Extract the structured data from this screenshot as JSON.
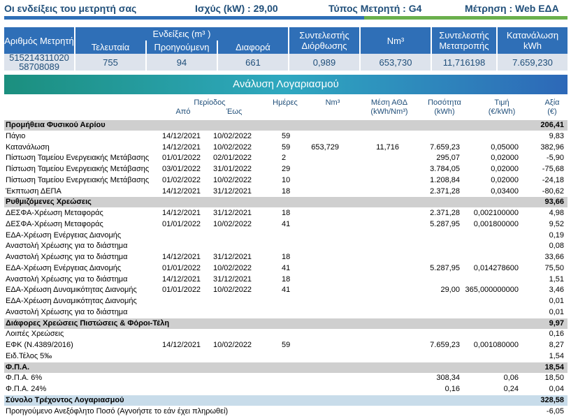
{
  "header": {
    "title": "Οι ενδείξεις του μετρητή σας",
    "power": "Ισχύς (kW) : 29,00",
    "meter_type": "Τύπος Μετρητή : G4",
    "measurement": "Μέτρηση : Web ΕΔΑ",
    "accent_blue": "#2f6fb7",
    "accent_green": "#6ab04c"
  },
  "meter_table": {
    "col_meter_no": "Αριθμός Μετρητή",
    "col_readings": "Ενδείξεις (m³ )",
    "col_last": "Τελευταία",
    "col_previous": "Προηγούμενη",
    "col_diff": "Διαφορά",
    "col_correction": "Συντελεστής Διόρθωσης",
    "col_nm3": "Nm³",
    "col_conversion": "Συντελεστής Μετατροπής",
    "col_kwh": "Κατανάλωση kWh",
    "meter_no_1": "515214311020",
    "meter_no_2": "58708089",
    "last": "755",
    "previous": "94",
    "diff": "661",
    "correction": "0,989",
    "nm3": "653,730",
    "conversion": "11,716198",
    "kwh": "7.659,230"
  },
  "analysis": {
    "title": "Ανάλυση Λογαριασμού",
    "headers": {
      "period": "Περίοδος",
      "from": "Από",
      "to": "Έως",
      "days": "Ημέρες",
      "nm3": "Nm³",
      "avg_1": "Μέση ΑΘΔ",
      "avg_2": "(kWh/Nm³)",
      "qty_1": "Ποσότητα",
      "qty_2": "(kWh)",
      "price_1": "Τιμή",
      "price_2": "(€/kWh)",
      "value_1": "Αξία",
      "value_2": "(€)"
    },
    "rows": [
      {
        "type": "section",
        "label": "Προμήθεια Φυσικού Αερίου",
        "value": "206,41"
      },
      {
        "label": "Πάγιο",
        "from": "14/12/2021",
        "to": "10/02/2022",
        "days": "59",
        "value": "9,83"
      },
      {
        "label": "Κατανάλωση",
        "from": "14/12/2021",
        "to": "10/02/2022",
        "days": "59",
        "nm3": "653,729",
        "avg": "11,716",
        "qty": "7.659,23",
        "price": "0,05000",
        "value": "382,96"
      },
      {
        "label": "Πίστωση Ταμείου Ενεργειακής Μετάβασης",
        "from": "01/01/2022",
        "to": "02/01/2022",
        "days": "2",
        "qty": "295,07",
        "price": "0,02000",
        "value": "-5,90"
      },
      {
        "label": "Πίστωση Ταμείου Ενεργειακής Μετάβασης",
        "from": "03/01/2022",
        "to": "31/01/2022",
        "days": "29",
        "qty": "3.784,05",
        "price": "0,02000",
        "value": "-75,68"
      },
      {
        "label": "Πίστωση Ταμείου Ενεργειακής Μετάβασης",
        "from": "01/02/2022",
        "to": "10/02/2022",
        "days": "10",
        "qty": "1.208,84",
        "price": "0,02000",
        "value": "-24,18"
      },
      {
        "label": "Έκπτωση ΔΕΠΑ",
        "from": "14/12/2021",
        "to": "31/12/2021",
        "days": "18",
        "qty": "2.371,28",
        "price": "0,03400",
        "value": "-80,62"
      },
      {
        "type": "section",
        "label": "Ρυθμιζόμενες Χρεώσεις",
        "value": "93,66"
      },
      {
        "label": "ΔΕΣΦΑ-Χρέωση Μεταφοράς",
        "from": "14/12/2021",
        "to": "31/12/2021",
        "days": "18",
        "qty": "2.371,28",
        "price": "0,002100000",
        "value": "4,98"
      },
      {
        "label": "ΔΕΣΦΑ-Χρέωση Μεταφοράς",
        "from": "01/01/2022",
        "to": "10/02/2022",
        "days": "41",
        "qty": "5.287,95",
        "price": "0,001800000",
        "value": "9,52"
      },
      {
        "label": "ΕΔΑ-Χρέωση Ενέργειας Διανομής",
        "value": "0,19"
      },
      {
        "label": "Αναστολή Χρέωσης για το διάστημα",
        "value": "0,08"
      },
      {
        "label": "Αναστολή Χρέωσης για το διάστημα",
        "from": "14/12/2021",
        "to": "31/12/2021",
        "days": "18",
        "value": "33,66"
      },
      {
        "label": "ΕΔΑ-Χρέωση Ενέργειας Διανομής",
        "from": "01/01/2022",
        "to": "10/02/2022",
        "days": "41",
        "qty": "5.287,95",
        "price": "0,014278600",
        "value": "75,50"
      },
      {
        "label": "Αναστολή Χρέωσης για το διάστημα",
        "from": "14/12/2021",
        "to": "31/12/2021",
        "days": "18",
        "value": "1,51"
      },
      {
        "label": "ΕΔΑ-Χρέωση Δυναμικότητας Διανομής",
        "from": "01/01/2022",
        "to": "10/02/2022",
        "days": "41",
        "qty": "29,00",
        "price": "365,000000000",
        "value": "3,46"
      },
      {
        "label": "ΕΔΑ-Χρέωση Δυναμικότητας Διανομής",
        "value": "0,01"
      },
      {
        "label": "Αναστολή Χρέωσης για το διάστημα",
        "value": "0,01"
      },
      {
        "type": "section",
        "label": "Διάφορες Χρεώσεις Πιστώσεις & Φόροι-Τέλη",
        "value": "9,97"
      },
      {
        "label": "Λοιπές Χρεώσεις",
        "value": "0,16"
      },
      {
        "label": "ΕΦΚ (Ν.4389/2016)",
        "from": "14/12/2021",
        "to": "10/02/2022",
        "days": "59",
        "qty": "7.659,23",
        "price": "0,001080000",
        "value": "8,27"
      },
      {
        "label": "Ειδ.Τέλος 5‰",
        "value": "1,54"
      },
      {
        "type": "section",
        "label": "Φ.Π.Α.",
        "value": "18,54"
      },
      {
        "label": "Φ.Π.Α. 6%",
        "qty": "308,34",
        "price": "0,06",
        "value": "18,50"
      },
      {
        "label": "Φ.Π.Α. 24%",
        "qty": "0,16",
        "price": "0,24",
        "value": "0,04"
      },
      {
        "type": "total",
        "label": "Σύνολο Τρέχοντος Λογαριασμού",
        "value": "328,58"
      },
      {
        "label": "Προηγούμενο Ανεξόφλητο Ποσό (Αγνοήστε το εάν έχει πληρωθεί)",
        "value": "-6,05"
      }
    ]
  }
}
